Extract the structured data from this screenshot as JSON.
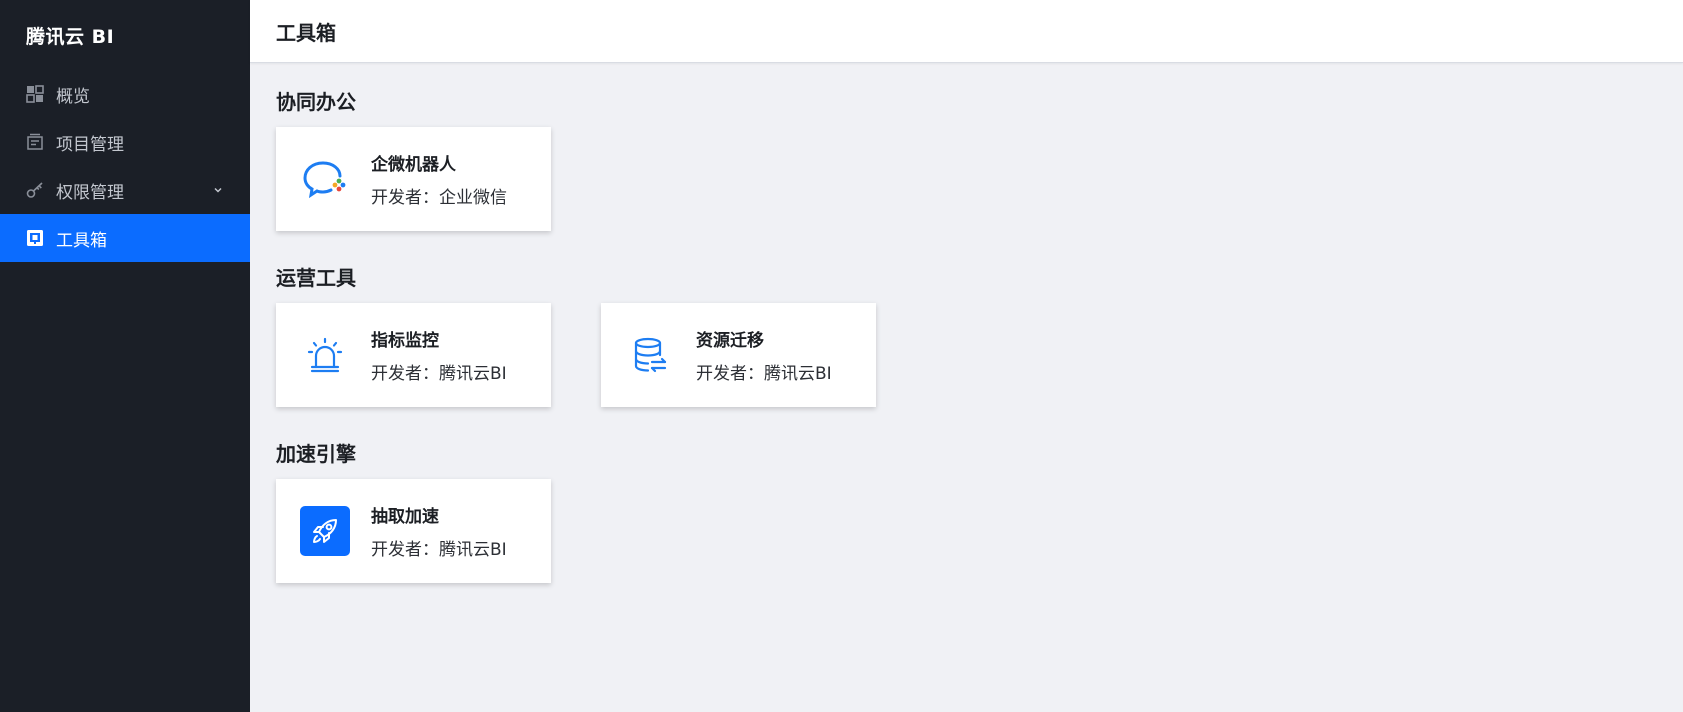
{
  "sidebar": {
    "brand": "腾讯云 BI",
    "items": [
      {
        "label": "概览",
        "icon": "dashboard-grid-icon"
      },
      {
        "label": "项目管理",
        "icon": "project-icon"
      },
      {
        "label": "权限管理",
        "icon": "key-icon",
        "has_submenu": true
      },
      {
        "label": "工具箱",
        "icon": "toolbox-icon",
        "active": true
      }
    ]
  },
  "header": {
    "title": "工具箱"
  },
  "sections": [
    {
      "title": "协同办公",
      "cards": [
        {
          "title": "企微机器人",
          "developer_prefix": "开发者：",
          "developer": "企业微信",
          "icon": "wecom-robot-icon"
        }
      ]
    },
    {
      "title": "运营工具",
      "cards": [
        {
          "title": "指标监控",
          "developer_prefix": "开发者：",
          "developer": "腾讯云BI",
          "icon": "alarm-icon"
        },
        {
          "title": "资源迁移",
          "developer_prefix": "开发者：",
          "developer": "腾讯云BI",
          "icon": "database-migrate-icon"
        }
      ]
    },
    {
      "title": "加速引擎",
      "cards": [
        {
          "title": "抽取加速",
          "developer_prefix": "开发者：",
          "developer": "腾讯云BI",
          "icon": "rocket-icon"
        }
      ]
    }
  ],
  "colors": {
    "sidebar_bg": "#1b1f27",
    "accent": "#0b6cff",
    "page_bg": "#f0f1f5"
  }
}
